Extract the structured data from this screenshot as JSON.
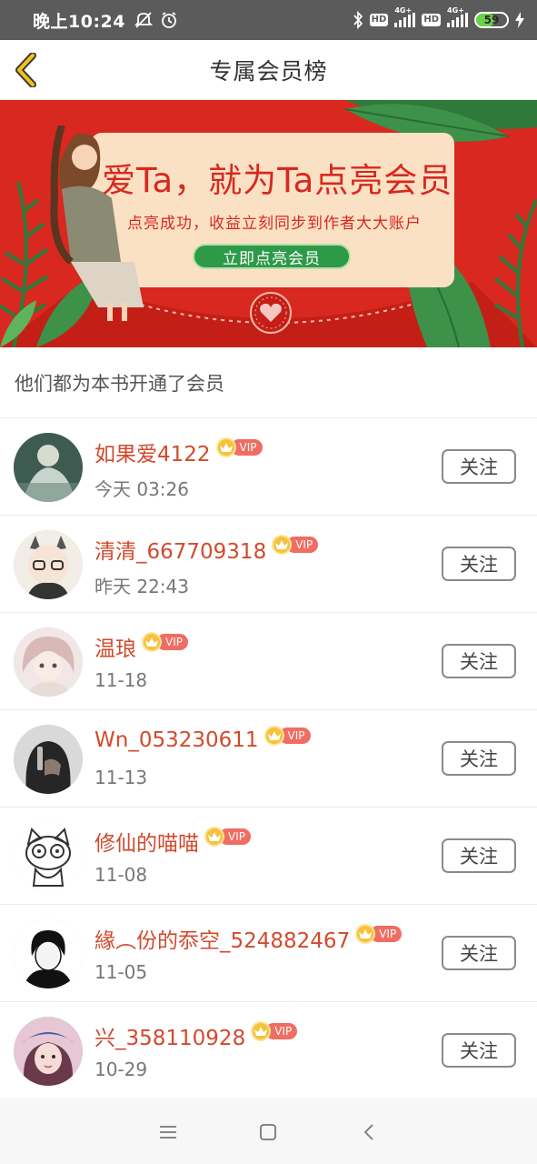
{
  "status_bar": {
    "time": "晚上10:24",
    "battery": "59",
    "battery_level": 0.59,
    "icons": [
      "mute-icon",
      "alarm-icon",
      "bluetooth-icon",
      "hd-icon",
      "signal-4g-icon",
      "hd-icon",
      "signal-4g-icon",
      "battery-icon",
      "charging-icon"
    ],
    "hd_label": "HD",
    "network_label": "4G+"
  },
  "header": {
    "title": "专属会员榜",
    "back_icon": "back-chevron-icon",
    "accent": "#f2c21a"
  },
  "banner": {
    "headline": "爱Ta，就为Ta点亮会员",
    "subtitle": "点亮成功，收益立刻同步到作者大大账户",
    "cta": "立即点亮会员",
    "bg_color": "#d8281f",
    "card_color": "#fbe1c4",
    "cta_color": "#2d9a4a"
  },
  "section": {
    "label": "他们都为本书开通了会员"
  },
  "vip_badge": "VIP",
  "follow_label": "关注",
  "members": [
    {
      "name": "如果爱4122",
      "date": "今天 03:26"
    },
    {
      "name": "清清_667709318",
      "date": "昨天 22:43"
    },
    {
      "name": "温琅",
      "date": "11-18"
    },
    {
      "name": "Wn_053230611",
      "date": "11-13"
    },
    {
      "name": "修仙的喵喵",
      "date": "11-08"
    },
    {
      "name": "緣︵份的忝空_524882467",
      "date": "11-05"
    },
    {
      "name": "兴_358110928",
      "date": "10-29"
    }
  ],
  "nav": {
    "icons": [
      "menu-icon",
      "home-square-icon",
      "back-triangle-icon"
    ]
  }
}
